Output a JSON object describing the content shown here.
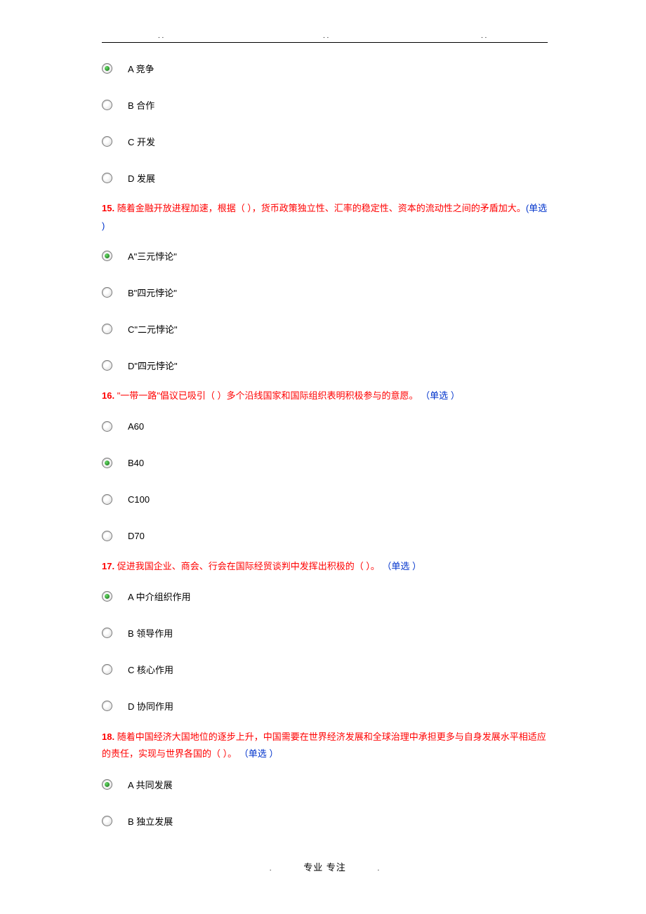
{
  "topDots": ". .",
  "questions": [
    {
      "num": "",
      "body": "",
      "tag": "",
      "options": [
        {
          "label": "A 竞争",
          "selected": true
        },
        {
          "label": "B 合作",
          "selected": false
        },
        {
          "label": "C 开发",
          "selected": false
        },
        {
          "label": "D 发展",
          "selected": false
        }
      ]
    },
    {
      "num": "15. ",
      "body": "随着金融开放进程加速，根据（ ），货币政策独立性、汇率的稳定性、资本的流动性之间的矛盾加大。",
      "tag": "(单选  )",
      "bodyIsRed": true,
      "options": [
        {
          "label": "A\"三元悖论\"",
          "selected": true
        },
        {
          "label": "B\"四元悖论\"",
          "selected": false
        },
        {
          "label": "C\"二元悖论\"",
          "selected": false
        },
        {
          "label": "D\"四元悖论\"",
          "selected": false
        }
      ]
    },
    {
      "num": "16. ",
      "body": "\"一带一路\"倡议已吸引（ ）多个沿线国家和国际组织表明积极参与的意愿。 ",
      "tag": "（单选  ）",
      "bodyIsRed": true,
      "options": [
        {
          "label": "A60",
          "selected": false
        },
        {
          "label": "B40",
          "selected": true
        },
        {
          "label": "C100",
          "selected": false
        },
        {
          "label": "D70",
          "selected": false
        }
      ]
    },
    {
      "num": "17. ",
      "body": "促进我国企业、商会、行会在国际经贸谈判中发挥出积极的（ ）。 ",
      "tag": "（单选  ）",
      "bodyIsRed": true,
      "options": [
        {
          "label": "A 中介组织作用",
          "selected": true
        },
        {
          "label": "B 领导作用",
          "selected": false
        },
        {
          "label": "C 核心作用",
          "selected": false
        },
        {
          "label": "D 协同作用",
          "selected": false
        }
      ]
    },
    {
      "num": "18. ",
      "body": "随着中国经济大国地位的逐步上升，中国需要在世界经济发展和全球治理中承担更多与自身发展水平相适应的责任，实现与世界各国的（ ）。 ",
      "tag": "（单选  ）",
      "bodyIsRed": true,
      "options": [
        {
          "label": "A 共同发展",
          "selected": true
        },
        {
          "label": "B 独立发展",
          "selected": false
        }
      ]
    }
  ],
  "footer": {
    "left": ".",
    "center": "专业  专注",
    "right": "."
  }
}
